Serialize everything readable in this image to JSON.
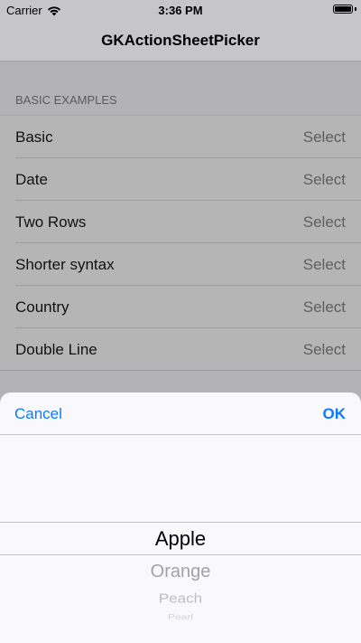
{
  "status_bar": {
    "carrier": "Carrier",
    "time": "3:36 PM"
  },
  "nav": {
    "title": "GKActionSheetPicker"
  },
  "section": {
    "header": "BASIC EXAMPLES"
  },
  "rows": [
    {
      "label": "Basic",
      "detail": "Select"
    },
    {
      "label": "Date",
      "detail": "Select"
    },
    {
      "label": "Two Rows",
      "detail": "Select"
    },
    {
      "label": "Shorter syntax",
      "detail": "Select"
    },
    {
      "label": "Country",
      "detail": "Select"
    },
    {
      "label": "Double Line",
      "detail": "Select"
    }
  ],
  "sheet": {
    "cancel_label": "Cancel",
    "ok_label": "OK",
    "picker": {
      "selected": "Apple",
      "items": [
        "Apple",
        "Orange",
        "Peach",
        "Pearl"
      ]
    }
  },
  "colors": {
    "tint": "#0a7aff"
  }
}
